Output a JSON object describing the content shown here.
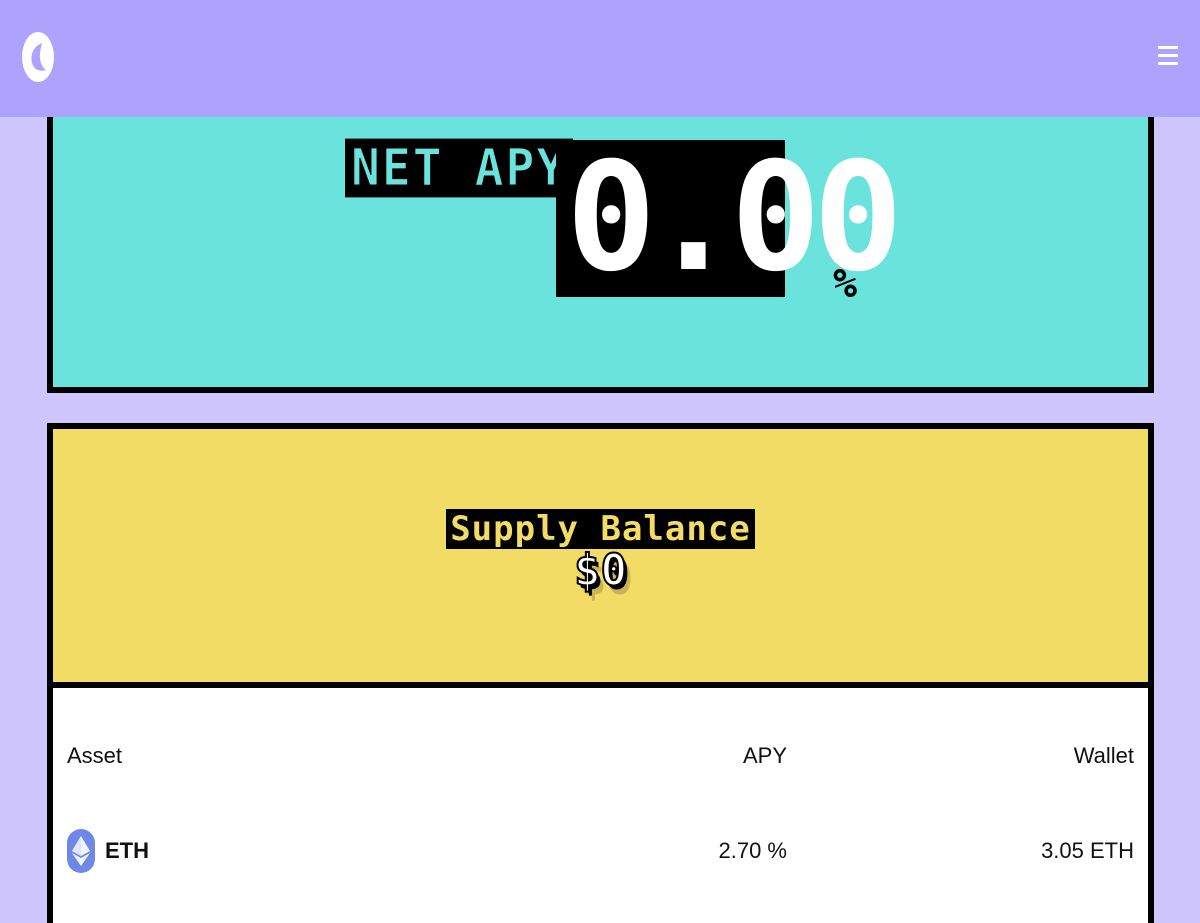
{
  "header": {
    "logo_icon": "kash-logo-icon",
    "menu_icon": "hamburger-menu-icon"
  },
  "net_apy": {
    "label": "NET APY",
    "value": "0.00",
    "unit": "%"
  },
  "supply": {
    "title": "Supply Balance",
    "amount": "$0"
  },
  "table": {
    "headers": {
      "asset": "Asset",
      "apy": "APY",
      "wallet": "Wallet"
    },
    "rows": [
      {
        "asset": "ETH",
        "icon": "ethereum-icon",
        "apy": "2.70 %",
        "wallet": "3.05 ETH"
      }
    ]
  },
  "colors": {
    "topbar": "#aea3fc",
    "page_bg": "#cfc6fd",
    "apy_card": "#6be3dd",
    "supply_header": "#f2dc66",
    "eth_icon": "#6f87e6"
  }
}
